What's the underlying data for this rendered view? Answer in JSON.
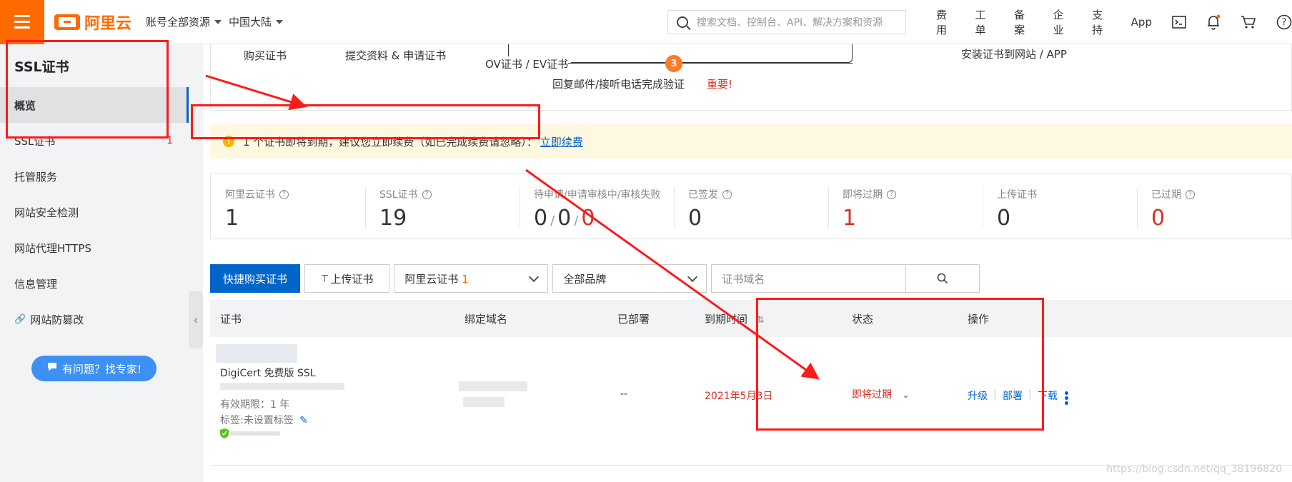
{
  "header": {
    "brand": "阿里云",
    "account_scope": "账号全部资源",
    "region": "中国大陆",
    "search_placeholder": "搜索文档、控制台、API、解决方案和资源",
    "links": [
      "费用",
      "工单",
      "备案",
      "企业",
      "支持",
      "App"
    ],
    "icons": [
      "terminal-icon",
      "bell-icon",
      "cart-icon",
      "help-icon"
    ]
  },
  "sidebar": {
    "title": "SSL证书",
    "items": [
      {
        "label": "概览",
        "active": true
      },
      {
        "label": "SSL证书",
        "badge": "1"
      },
      {
        "label": "托管服务"
      },
      {
        "label": "网站安全检测"
      },
      {
        "label": "网站代理HTTPS"
      },
      {
        "label": "信息管理"
      },
      {
        "label": "网站防篡改",
        "icon": "link-icon"
      }
    ],
    "help_button": "有问题？找专家!"
  },
  "steps": {
    "buy": "购买证书",
    "apply": "提交资料 & 申请证书",
    "ov_ev": "OV证书 / EV证书",
    "step_number": "3",
    "verify": "回复邮件/接听电话完成验证",
    "important": "重要!",
    "install": "安装证书到网站 / APP"
  },
  "alert": {
    "text": "1 个证书即将到期，建议您立即续费（如已完成续费请忽略）：",
    "link": "立即续费"
  },
  "stats": [
    {
      "label": "阿里云证书",
      "value": "1",
      "help": true
    },
    {
      "label": "SSL证书",
      "value": "19",
      "help": true
    },
    {
      "label": "待申请/申请审核中/审核失败",
      "values": [
        "0",
        "0",
        "0"
      ]
    },
    {
      "label": "已签发",
      "value": "0",
      "help": true
    },
    {
      "label": "即将过期",
      "value": "1",
      "help": true,
      "red": true
    },
    {
      "label": "上传证书",
      "value": "0"
    },
    {
      "label": "已过期",
      "value": "0",
      "help": true,
      "red": true
    }
  ],
  "toolbar": {
    "buy_button": "快捷购买证书",
    "upload_button": "上传证书",
    "cert_type": "阿里云证书",
    "cert_type_count": "1",
    "brand_filter": "全部品牌",
    "domain_placeholder": "证书域名"
  },
  "table": {
    "headers": [
      "证书",
      "绑定域名",
      "已部署",
      "到期时间",
      "状态",
      "操作"
    ],
    "rows": [
      {
        "name": "DigiCert 免费版 SSL",
        "validity": "有效期限：1 年",
        "tag": "标签:未设置标签",
        "deployed": "--",
        "expiry": "2021年5月3日",
        "status": "即将过期",
        "actions": [
          "升级",
          "部署",
          "下载"
        ]
      }
    ]
  },
  "watermark": "https://blog.csdn.net/qq_38196820",
  "colors": {
    "accent": "#ff6a00",
    "primary": "#0064c8",
    "danger": "#d93026",
    "annotation": "#ff1a1a"
  }
}
